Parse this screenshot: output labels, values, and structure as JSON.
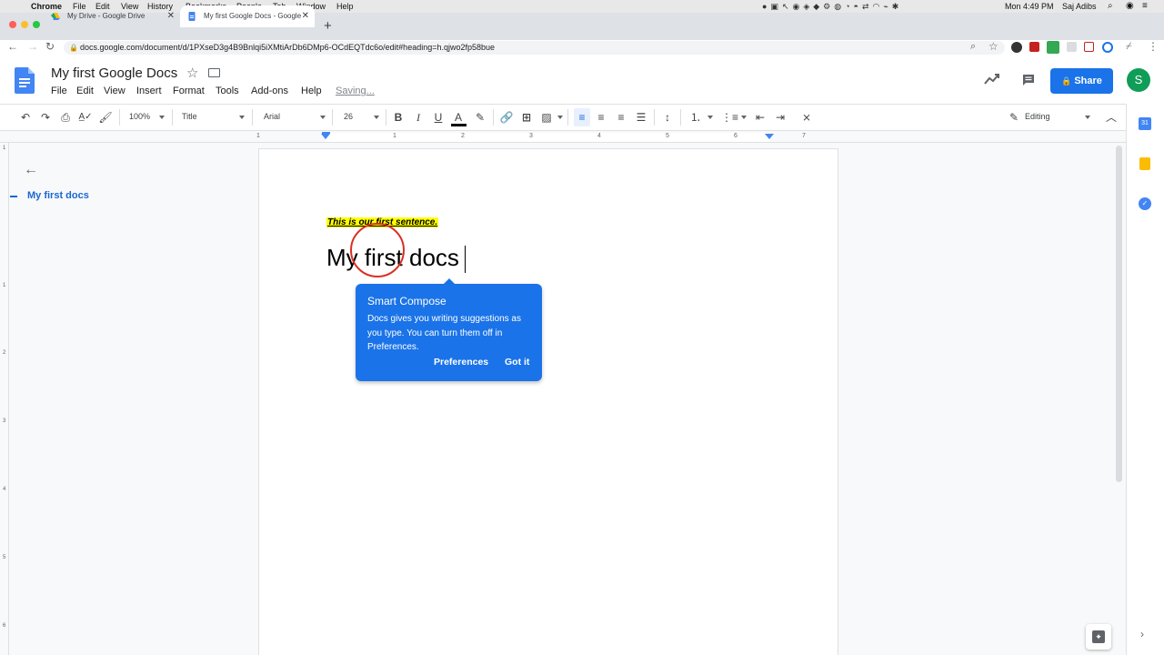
{
  "macos": {
    "menus": [
      "Chrome",
      "File",
      "Edit",
      "View",
      "History",
      "Bookmarks",
      "People",
      "Tab",
      "Window",
      "Help"
    ],
    "clock": "Mon 4:49 PM",
    "user": "Saj Adibs"
  },
  "browser": {
    "tabs": [
      {
        "title": "My Drive - Google Drive",
        "active": false
      },
      {
        "title": "My first Google Docs - Google",
        "active": true
      }
    ],
    "new_tab": "+",
    "url": "docs.google.com/document/d/1PXseD3g4B9Bnlqi5iXMtiArDb6DMp6-OCdEQTdc6o/edit#heading=h.qjwo2fp58bue"
  },
  "docs": {
    "title": "My first Google Docs",
    "menus": [
      "File",
      "Edit",
      "View",
      "Insert",
      "Format",
      "Tools",
      "Add-ons",
      "Help"
    ],
    "saving": "Saving...",
    "share": "Share",
    "avatar": "S",
    "toolbar": {
      "zoom": "100%",
      "style": "Title",
      "font": "Arial",
      "size": "26",
      "bold": "B",
      "italic": "I",
      "underline": "U",
      "text_color": "A",
      "mode": "Editing"
    }
  },
  "ruler": {
    "numbers": [
      "1",
      "1",
      "2",
      "3",
      "4",
      "5",
      "6",
      "7"
    ],
    "vertical": [
      "1",
      "1",
      "2",
      "3",
      "4",
      "5",
      "6"
    ]
  },
  "outline": {
    "back": "←",
    "item": "My first docs"
  },
  "document": {
    "first_sentence": "This is our first sentence.",
    "heading": "My first docs"
  },
  "smart_compose": {
    "title": "Smart Compose",
    "body": "Docs gives you writing suggestions as you type. You can turn them off in Preferences.",
    "preferences": "Preferences",
    "got_it": "Got it"
  },
  "colors": {
    "accent": "#1a73e8",
    "highlight": "#ffff00",
    "annotation_circle": "#d93025"
  }
}
